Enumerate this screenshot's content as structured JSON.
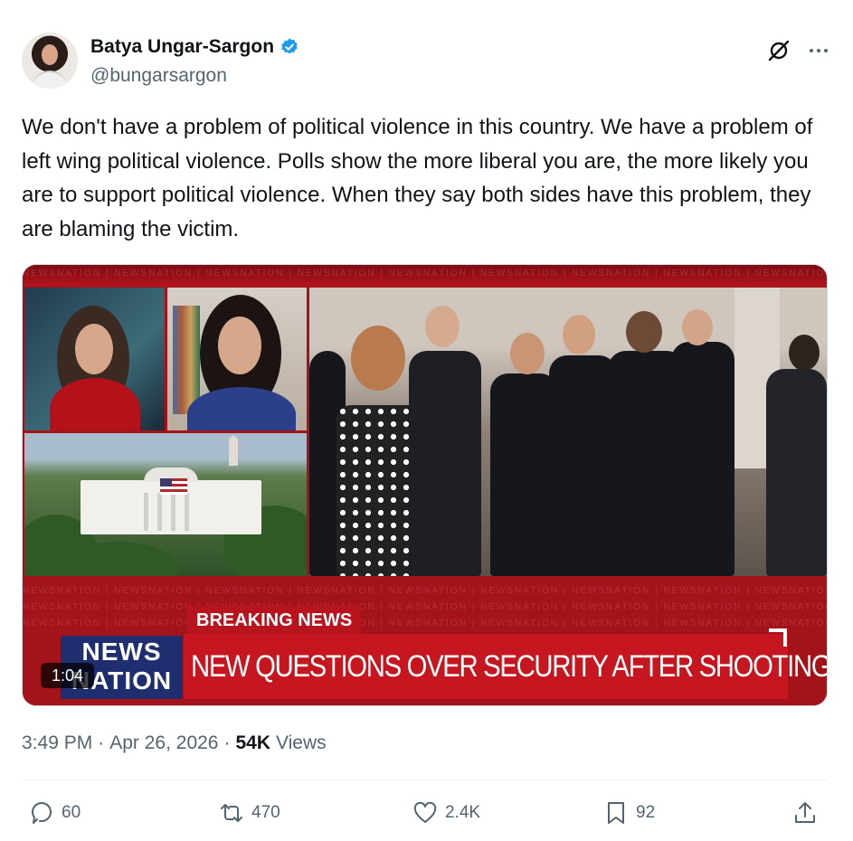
{
  "author": {
    "display_name": "Batya Ungar-Sargon",
    "handle": "@bungarsargon",
    "verified": true,
    "verified_color": "#1d9bf0"
  },
  "header_icons": [
    "grok-icon",
    "more-icon"
  ],
  "tweet": {
    "text": "We don't have a problem of political violence in this country. We have a problem of left wing political violence. Polls show the more liberal you are, the more likely you are to support political violence. When they say both sides have this problem, they are blaming the victim."
  },
  "video": {
    "duration": "1:04",
    "breaking_label": "BREAKING NEWS",
    "headline": "NEW QUESTIONS OVER SECURITY AFTER SHOOTING",
    "logo_top": "NEWS",
    "logo_bottom": "NATION",
    "watermark": "NEWSNATION",
    "accent": "#c6161f"
  },
  "meta": {
    "time": "3:49 PM",
    "date": "Apr 26, 2026",
    "separator": "·",
    "views_count": "54K",
    "views_label": "Views"
  },
  "actions": {
    "replies": "60",
    "reposts": "470",
    "likes": "2.4K",
    "bookmarks": "92"
  }
}
